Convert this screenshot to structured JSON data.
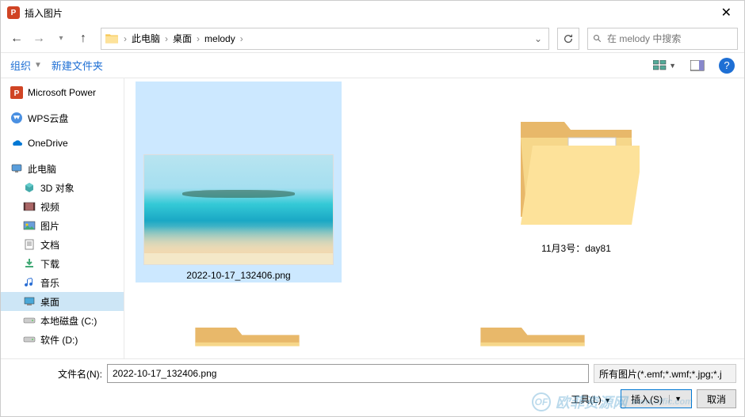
{
  "title": "插入图片",
  "breadcrumbs": [
    "此电脑",
    "桌面",
    "melody"
  ],
  "search_placeholder": "在 melody 中搜索",
  "toolbar": {
    "organize": "组织",
    "new_folder": "新建文件夹"
  },
  "sidebar": [
    {
      "label": "Microsoft Power",
      "icon": "pp",
      "indent": false
    },
    {
      "label": "WPS云盘",
      "icon": "wps",
      "indent": false,
      "spacer_before": true
    },
    {
      "label": "OneDrive",
      "icon": "onedrive",
      "indent": false,
      "spacer_before": true
    },
    {
      "label": "此电脑",
      "icon": "thispc",
      "indent": false,
      "spacer_before": true
    },
    {
      "label": "3D 对象",
      "icon": "3d",
      "indent": true
    },
    {
      "label": "视频",
      "icon": "video",
      "indent": true
    },
    {
      "label": "图片",
      "icon": "pictures",
      "indent": true
    },
    {
      "label": "文档",
      "icon": "docs",
      "indent": true
    },
    {
      "label": "下载",
      "icon": "downloads",
      "indent": true
    },
    {
      "label": "音乐",
      "icon": "music",
      "indent": true
    },
    {
      "label": "桌面",
      "icon": "desktop",
      "indent": true,
      "selected": true
    },
    {
      "label": "本地磁盘 (C:)",
      "icon": "disk",
      "indent": true
    },
    {
      "label": "软件 (D:)",
      "icon": "disk",
      "indent": true
    }
  ],
  "content_items": [
    {
      "name": "2022-10-17_132406.png",
      "type": "image",
      "selected": true
    },
    {
      "name": "11月3号：day81",
      "type": "folder",
      "selected": false
    }
  ],
  "footer": {
    "filename_label": "文件名(N):",
    "filename_value": "2022-10-17_132406.png",
    "filter": "所有图片(*.emf;*.wmf;*.jpg;*.j",
    "tools": "工具(L)",
    "insert": "插入(S)",
    "cancel": "取消"
  },
  "watermark": "欧菲资源网"
}
